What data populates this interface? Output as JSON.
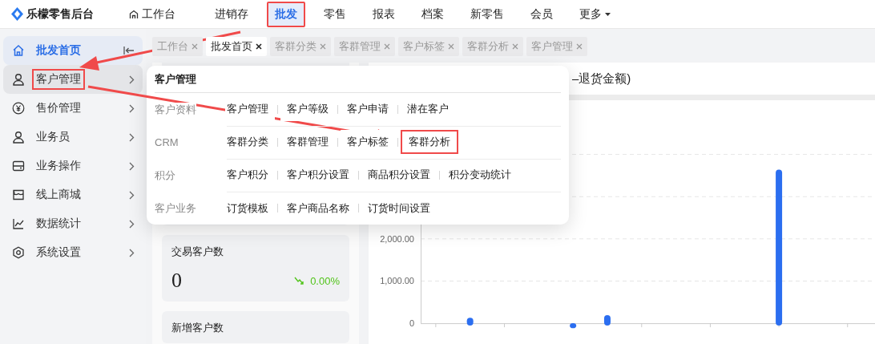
{
  "app": {
    "name": "乐檬零售后台"
  },
  "top_nav": [
    {
      "label": "工作台",
      "kind": "home",
      "selected": false,
      "highlighted": false
    },
    {
      "label": "进销存",
      "kind": "plain",
      "selected": false,
      "highlighted": false
    },
    {
      "label": "批发",
      "kind": "plain",
      "selected": true,
      "highlighted": true
    },
    {
      "label": "零售",
      "kind": "plain",
      "selected": false,
      "highlighted": false
    },
    {
      "label": "报表",
      "kind": "plain",
      "selected": false,
      "highlighted": false
    },
    {
      "label": "档案",
      "kind": "plain",
      "selected": false,
      "highlighted": false
    },
    {
      "label": "新零售",
      "kind": "plain",
      "selected": false,
      "highlighted": false
    },
    {
      "label": "会员",
      "kind": "plain",
      "selected": false,
      "highlighted": false
    },
    {
      "label": "更多",
      "kind": "menu",
      "selected": false,
      "highlighted": false
    }
  ],
  "sidebar": {
    "items": [
      {
        "label": "批发首页",
        "selected": true,
        "hovered": false,
        "highlighted": false
      },
      {
        "label": "客户管理",
        "selected": false,
        "hovered": true,
        "highlighted": true
      },
      {
        "label": "售价管理",
        "selected": false,
        "hovered": false,
        "highlighted": false
      },
      {
        "label": "业务员",
        "selected": false,
        "hovered": false,
        "highlighted": false
      },
      {
        "label": "业务操作",
        "selected": false,
        "hovered": false,
        "highlighted": false
      },
      {
        "label": "线上商城",
        "selected": false,
        "hovered": false,
        "highlighted": false
      },
      {
        "label": "数据统计",
        "selected": false,
        "hovered": false,
        "highlighted": false
      },
      {
        "label": "系统设置",
        "selected": false,
        "hovered": false,
        "highlighted": false
      }
    ]
  },
  "tabs": [
    {
      "label": "工作台",
      "selected": false
    },
    {
      "label": "批发首页",
      "selected": true
    },
    {
      "label": "客群分类",
      "selected": false
    },
    {
      "label": "客群管理",
      "selected": false
    },
    {
      "label": "客户标签",
      "selected": false
    },
    {
      "label": "客群分析",
      "selected": false
    },
    {
      "label": "客户管理",
      "selected": false
    }
  ],
  "dropdown": {
    "title": "客户管理",
    "groups": [
      {
        "label": "客户资料",
        "links": [
          {
            "label": "客户管理",
            "highlighted": false
          },
          {
            "label": "客户等级",
            "highlighted": false
          },
          {
            "label": "客户申请",
            "highlighted": false
          },
          {
            "label": "潜在客户",
            "highlighted": false
          }
        ]
      },
      {
        "label": "CRM",
        "links": [
          {
            "label": "客群分类",
            "highlighted": false
          },
          {
            "label": "客群管理",
            "highlighted": false
          },
          {
            "label": "客户标签",
            "highlighted": false
          },
          {
            "label": "客群分析",
            "highlighted": true
          }
        ]
      },
      {
        "label": "积分",
        "links": [
          {
            "label": "客户积分",
            "highlighted": false
          },
          {
            "label": "客户积分设置",
            "highlighted": false
          },
          {
            "label": "商品积分设置",
            "highlighted": false
          },
          {
            "label": "积分变动统计",
            "highlighted": false
          }
        ]
      },
      {
        "label": "客户业务",
        "links": [
          {
            "label": "订货模板",
            "highlighted": false
          },
          {
            "label": "客户商品名称",
            "highlighted": false
          },
          {
            "label": "订货时间设置",
            "highlighted": false
          }
        ]
      }
    ]
  },
  "cards": [
    {
      "title": "交易客户数",
      "value": "0",
      "change": "0.00%",
      "trend_down": true
    },
    {
      "title": "新增客户数"
    }
  ],
  "chart": {
    "title": "–退货金额)",
    "y_axis_labels": [
      "2,000.00",
      "1,000.00",
      "0"
    ]
  }
}
